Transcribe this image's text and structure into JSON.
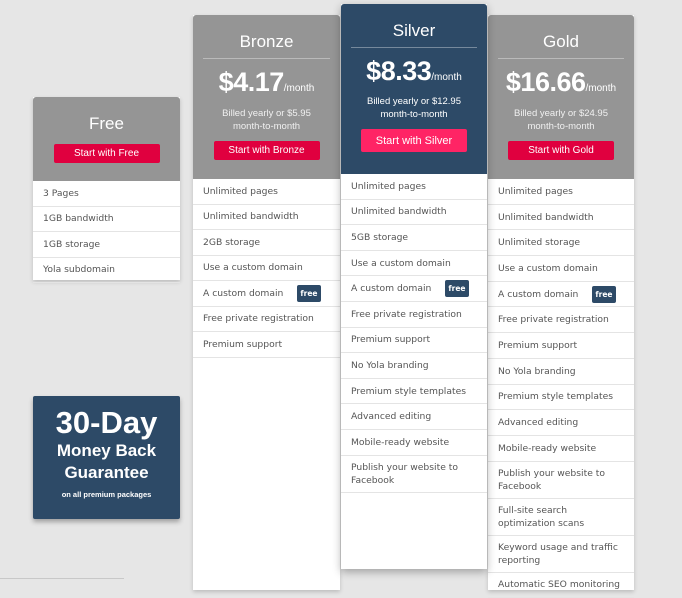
{
  "plans": [
    {
      "name": "Free",
      "cta": "Start with Free",
      "features": [
        "3 Pages",
        "1GB bandwidth",
        "1GB storage",
        "Yola subdomain"
      ]
    },
    {
      "name": "Bronze",
      "price": "$4.17",
      "per": "/month",
      "billing": "Billed yearly or $5.95 month-to-month",
      "cta": "Start with Bronze",
      "features": [
        "Unlimited pages",
        "Unlimited bandwidth",
        "2GB storage",
        "Use a custom domain",
        "A custom domain",
        "Free private registration",
        "Premium support"
      ]
    },
    {
      "name": "Silver",
      "price": "$8.33",
      "per": "/month",
      "billing": "Billed yearly or $12.95 month-to-month",
      "cta": "Start with Silver",
      "features": [
        "Unlimited pages",
        "Unlimited bandwidth",
        "5GB storage",
        "Use a custom domain",
        "A custom domain",
        "Free private registration",
        "Premium support",
        "No Yola branding",
        "Premium style templates",
        "Advanced editing",
        "Mobile-ready website",
        "Publish your website to Facebook"
      ]
    },
    {
      "name": "Gold",
      "price": "$16.66",
      "per": "/month",
      "billing": "Billed yearly or $24.95 month-to-month",
      "cta": "Start with Gold",
      "features": [
        "Unlimited pages",
        "Unlimited bandwidth",
        "Unlimited storage",
        "Use a custom domain",
        "A custom domain",
        "Free private registration",
        "Premium support",
        "No Yola branding",
        "Premium style templates",
        "Advanced editing",
        "Mobile-ready website",
        "Publish your website to Facebook",
        "Full-site search optimization scans",
        "Keyword usage and traffic reporting",
        "Automatic SEO monitoring"
      ]
    }
  ],
  "badge_label": "free",
  "guarantee": {
    "line1": "30-Day",
    "line2": "Money Back",
    "line3": "Guarantee",
    "note": "on all premium packages"
  },
  "colors": {
    "accent": "#e0003f",
    "featured_accent": "#ff2465",
    "featured_bg": "#2d4a67",
    "header_bg": "#959595"
  }
}
